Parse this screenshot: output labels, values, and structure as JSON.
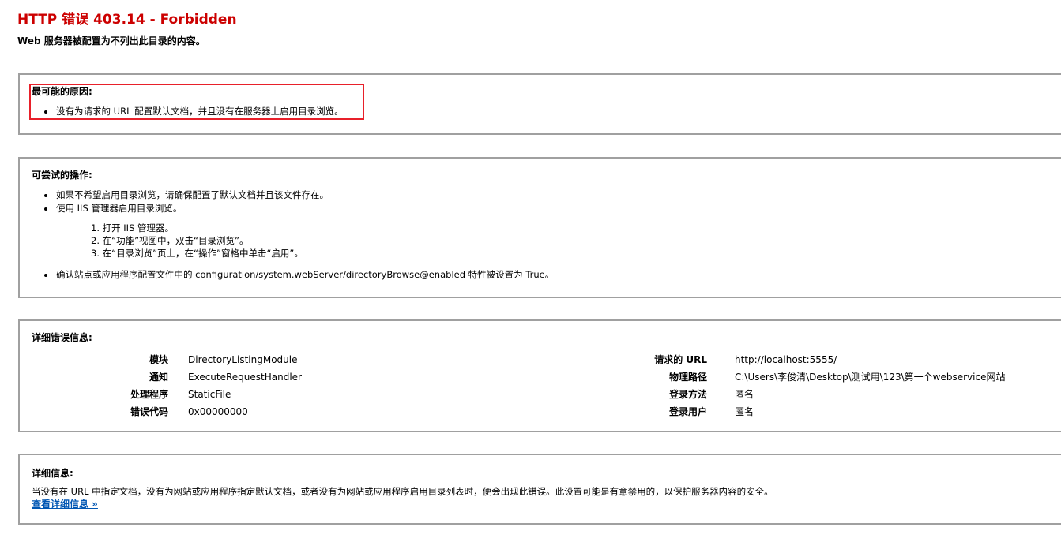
{
  "page": {
    "title": "HTTP 错误 403.14 - Forbidden",
    "subtitle": "Web 服务器被配置为不列出此目录的内容。"
  },
  "causes": {
    "heading": "最可能的原因:",
    "items": [
      "没有为请求的 URL 配置默认文档，并且没有在服务器上启用目录浏览。"
    ]
  },
  "actions": {
    "heading": "可尝试的操作:",
    "items": [
      "如果不希望启用目录浏览，请确保配置了默认文档并且该文件存在。",
      "使用 IIS 管理器启用目录浏览。",
      "确认站点或应用程序配置文件中的 configuration/system.webServer/directoryBrowse@enabled 特性被设置为 True。"
    ],
    "steps": [
      "1. 打开 IIS 管理器。",
      "2. 在“功能”视图中，双击“目录浏览”。",
      "3. 在“目录浏览”页上，在“操作”窗格中单击“启用”。"
    ]
  },
  "error_info": {
    "heading": "详细错误信息:",
    "left": [
      {
        "label": "模块",
        "value": "DirectoryListingModule"
      },
      {
        "label": "通知",
        "value": "ExecuteRequestHandler"
      },
      {
        "label": "处理程序",
        "value": "StaticFile"
      },
      {
        "label": "错误代码",
        "value": "0x00000000"
      }
    ],
    "right": [
      {
        "label": "请求的 URL",
        "value": "http://localhost:5555/"
      },
      {
        "label": "物理路径",
        "value": "C:\\Users\\李俊清\\Desktop\\测试用\\123\\第一个webservice网站"
      },
      {
        "label": "登录方法",
        "value": "匿名"
      },
      {
        "label": "登录用户",
        "value": "匿名"
      }
    ]
  },
  "details": {
    "heading": "详细信息:",
    "text": "当没有在 URL 中指定文档，没有为网站或应用程序指定默认文档，或者没有为网站或应用程序启用目录列表时，便会出现此错误。此设置可能是有意禁用的，以保护服务器内容的安全。",
    "link": "查看详细信息 »"
  },
  "colors": {
    "title": "#cc0000",
    "highlight_border": "#e8202a",
    "box_border": "#a0a0a0",
    "link": "#0056b3"
  }
}
